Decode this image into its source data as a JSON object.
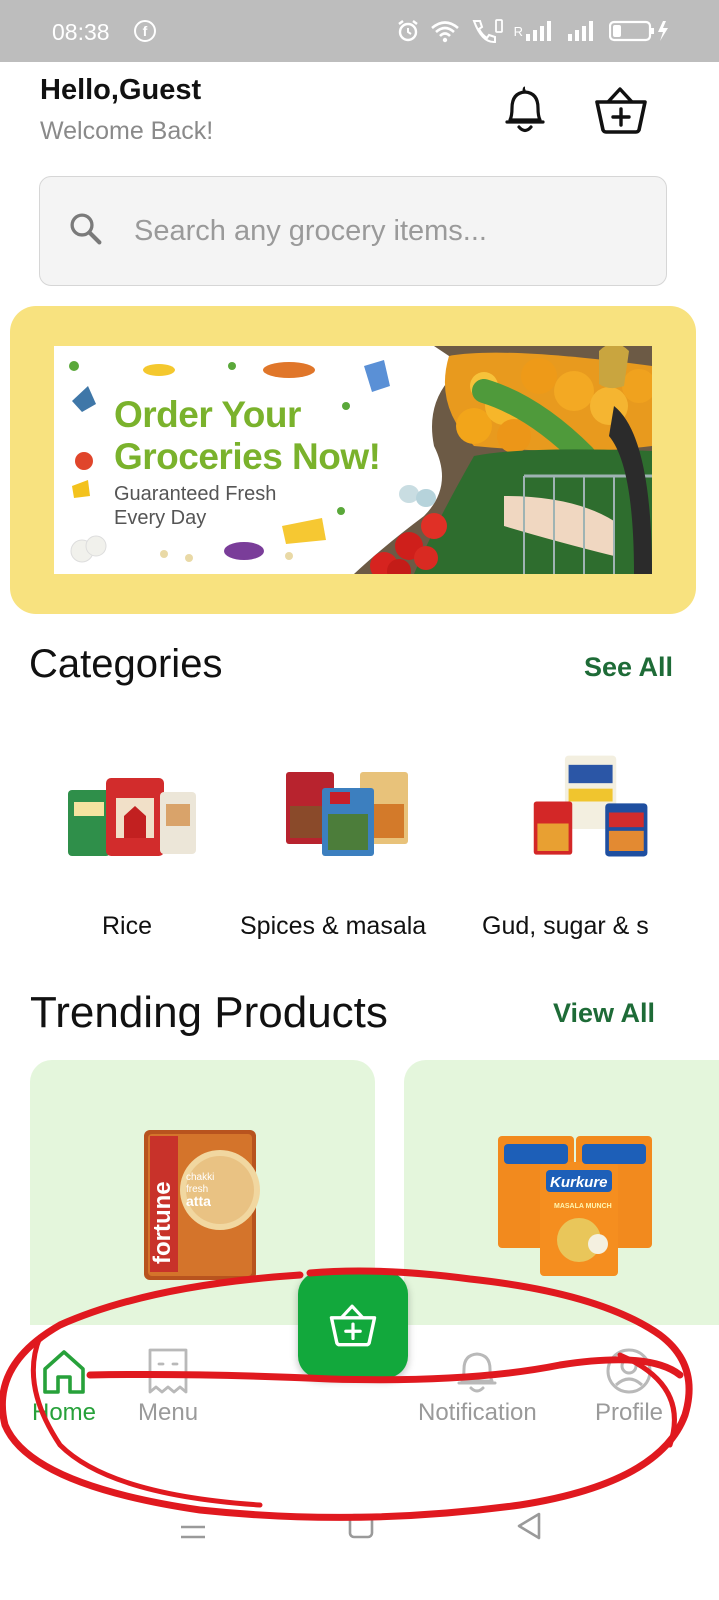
{
  "status_bar": {
    "time": "08:38",
    "fb_glyph": "f",
    "network_label": "R",
    "icons": [
      "facebook-icon",
      "alarm-icon",
      "wifi-icon",
      "volte-call-icon",
      "signal-icon",
      "battery-charging-icon"
    ]
  },
  "header": {
    "greeting": "Hello,Guest",
    "subtitle": "Welcome Back!",
    "icons": [
      "bell-icon",
      "basket-add-icon"
    ]
  },
  "search": {
    "placeholder": "Search any grocery items..."
  },
  "banner": {
    "title_line1": "Order Your",
    "title_line2": "Groceries Now!",
    "subtitle_line1": "Guaranteed Fresh",
    "subtitle_line2": "Every Day"
  },
  "categories": {
    "title": "Categories",
    "see_all": "See All",
    "items": [
      {
        "label": "Rice"
      },
      {
        "label": "Spices & masala"
      },
      {
        "label": "Gud, sugar & s"
      }
    ]
  },
  "trending": {
    "title": "Trending Products",
    "view_all": "View All",
    "products": [
      {
        "brand": "fortune",
        "line1": "chakki",
        "line2": "fresh",
        "line3": "atta"
      },
      {
        "brand": "Kurkure",
        "flavor": "MASALA MUNCH"
      }
    ]
  },
  "bottom_nav": {
    "items": [
      {
        "label": "Home",
        "icon": "home-icon",
        "active": true
      },
      {
        "label": "Menu",
        "icon": "receipt-icon",
        "active": false
      },
      {
        "label": "Notification",
        "icon": "bell-icon",
        "active": false
      },
      {
        "label": "Profile",
        "icon": "profile-icon",
        "active": false
      }
    ],
    "fab_icon": "basket-add-icon"
  },
  "colors": {
    "accent": "#12a83c",
    "link": "#1e6b37",
    "banner_bg": "#f8e27f",
    "card_bg": "#e4f6dc",
    "annotation": "#e0191f"
  }
}
